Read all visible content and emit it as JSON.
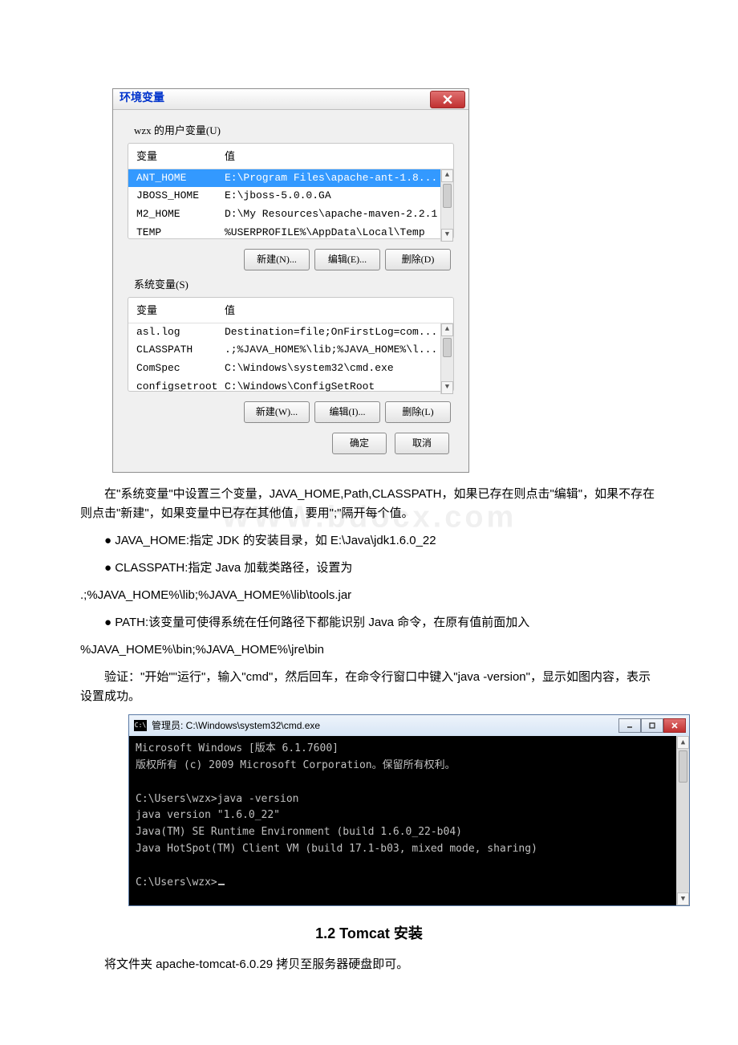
{
  "envDialog": {
    "title": "环境变量",
    "userVarsLabel": "wzx 的用户变量(U)",
    "systemVarsLabel": "系统变量(S)",
    "colVariable": "变量",
    "colValue": "值",
    "userVars": [
      {
        "name": "ANT_HOME",
        "value": "E:\\Program Files\\apache-ant-1.8..."
      },
      {
        "name": "JBOSS_HOME",
        "value": "E:\\jboss-5.0.0.GA"
      },
      {
        "name": "M2_HOME",
        "value": "D:\\My Resources\\apache-maven-2.2.1"
      },
      {
        "name": "TEMP",
        "value": "%USERPROFILE%\\AppData\\Local\\Temp"
      }
    ],
    "systemVars": [
      {
        "name": "asl.log",
        "value": "Destination=file;OnFirstLog=com..."
      },
      {
        "name": "CLASSPATH",
        "value": ".;%JAVA_HOME%\\lib;%JAVA_HOME%\\l..."
      },
      {
        "name": "ComSpec",
        "value": "C:\\Windows\\system32\\cmd.exe"
      },
      {
        "name": "configsetroot",
        "value": "C:\\Windows\\ConfigSetRoot"
      }
    ],
    "btnNewN": "新建(N)...",
    "btnEditE": "编辑(E)...",
    "btnDeleteD": "删除(D)",
    "btnNewW": "新建(W)...",
    "btnEditI": "编辑(I)...",
    "btnDeleteL": "删除(L)",
    "btnOk": "确定",
    "btnCancel": "取消"
  },
  "body": {
    "watermark": "WWW.bdocx.com",
    "p1": "在\"系统变量\"中设置三个变量，JAVA_HOME,Path,CLASSPATH，如果已存在则点击\"编辑\"，如果不存在则点击\"新建\"，如果变量中已存在其他值，要用\";\"隔开每个值。",
    "p2": "● JAVA_HOME:指定 JDK 的安装目录，如 E:\\Java\\jdk1.6.0_22",
    "p3a": "● CLASSPATH:指定 Java 加载类路径，设置为",
    "p3b": ".;%JAVA_HOME%\\lib;%JAVA_HOME%\\lib\\tools.jar",
    "p4a": "● PATH:该变量可使得系统在任何路径下都能识别 Java 命令，在原有值前面加入",
    "p4b": "%JAVA_HOME%\\bin;%JAVA_HOME%\\jre\\bin",
    "p5": "验证：\"开始\"\"运行\"，输入\"cmd\"，然后回车，在命令行窗口中键入\"java -version\"，显示如图内容，表示设置成功。",
    "h2": "1.2 Tomcat 安装",
    "p6": "将文件夹 apache-tomcat-6.0.29 拷贝至服务器硬盘即可。"
  },
  "cmd": {
    "title": "管理员: C:\\Windows\\system32\\cmd.exe",
    "lines": [
      "Microsoft Windows [版本 6.1.7600]",
      "版权所有 (c) 2009 Microsoft Corporation。保留所有权利。",
      "C:\\Users\\wzx>java -version",
      "java version \"1.6.0_22\"",
      "Java(TM) SE Runtime Environment (build 1.6.0_22-b04)",
      "Java HotSpot(TM) Client VM (build 17.1-b03, mixed mode, sharing)",
      "C:\\Users\\wzx>"
    ]
  }
}
